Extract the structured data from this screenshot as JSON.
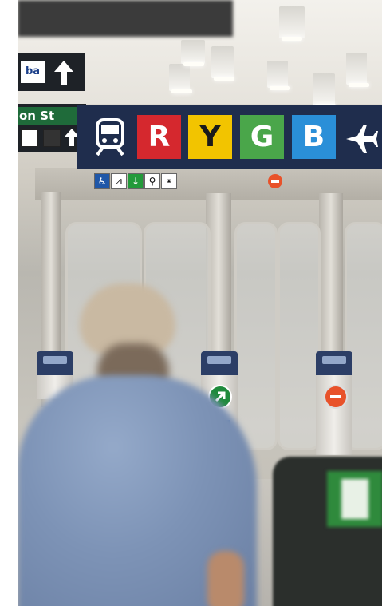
{
  "scene": {
    "description_alt": "",
    "signs": {
      "top_left_logo": "ba",
      "street_text": "on St",
      "line_letters": [
        "R",
        "Y",
        "G",
        "B"
      ],
      "line_colors": [
        "#d5282e",
        "#f2c400",
        "#4aa64a",
        "#2a8fd8"
      ]
    },
    "icons": [
      "train-icon",
      "airplane-icon",
      "arrow-up-icon",
      "wheelchair-icon",
      "enter-arrow-icon",
      "no-entry-icon",
      "bicycle-icon"
    ]
  }
}
